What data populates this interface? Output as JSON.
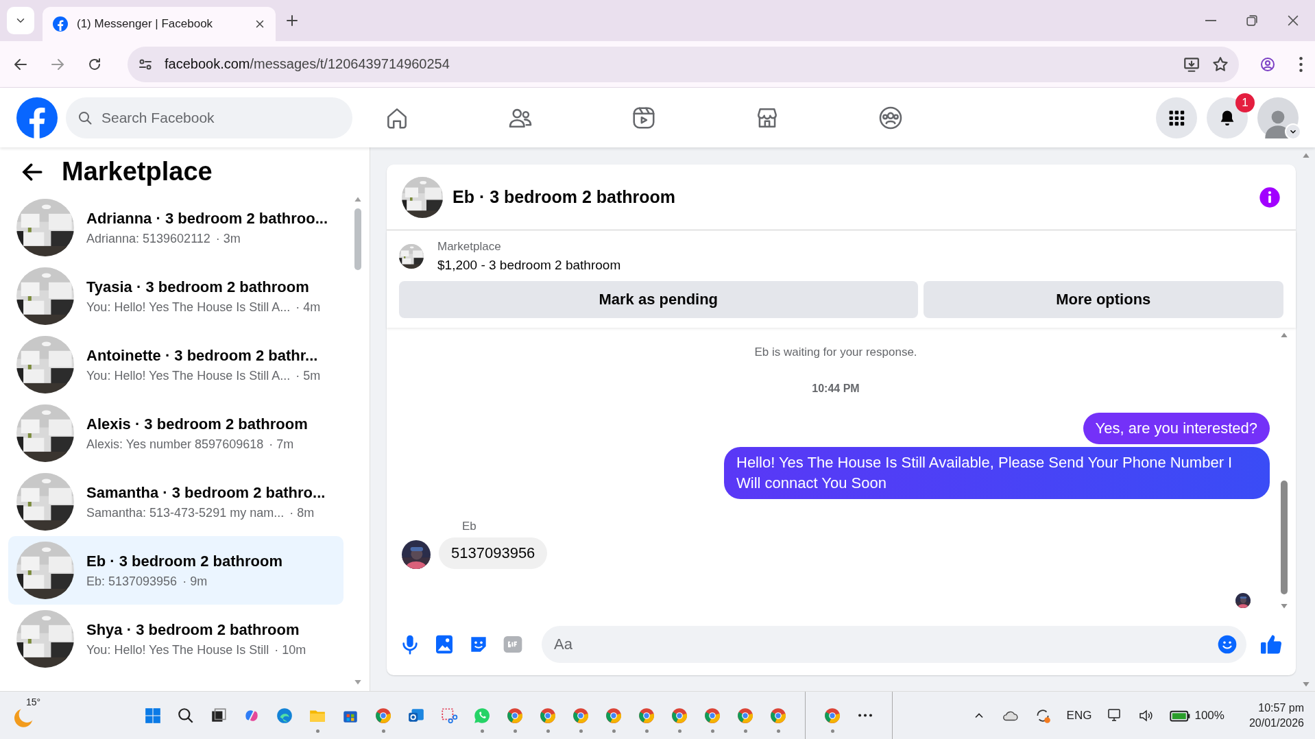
{
  "browser": {
    "tab_title": "(1) Messenger | Facebook",
    "url_host": "facebook.com",
    "url_path": "/messages/t/1206439714960254"
  },
  "header": {
    "search": {
      "placeholder": "Search Facebook"
    },
    "notification_count": "1"
  },
  "sidebar": {
    "title": "Marketplace",
    "conversations": [
      {
        "title": "Adrianna · 3 bedroom 2 bathroo...",
        "preview": "Adrianna: 5139602112",
        "time": "· 3m",
        "selected": false
      },
      {
        "title": "Tyasia · 3 bedroom 2 bathroom",
        "preview": "You: Hello! Yes The House Is Still A...",
        "time": "· 4m",
        "selected": false
      },
      {
        "title": "Antoinette · 3 bedroom 2 bathr...",
        "preview": "You: Hello! Yes The House Is Still A...",
        "time": "· 5m",
        "selected": false
      },
      {
        "title": "Alexis · 3 bedroom 2 bathroom",
        "preview": "Alexis: Yes number 8597609618",
        "time": "· 7m",
        "selected": false
      },
      {
        "title": "Samantha · 3 bedroom 2 bathro...",
        "preview": "Samantha: 513-473-5291 my nam...",
        "time": "· 8m",
        "selected": false
      },
      {
        "title": "Eb · 3 bedroom 2 bathroom",
        "preview": "Eb: 5137093956",
        "time": "· 9m",
        "selected": true
      },
      {
        "title": "Shya · 3 bedroom 2 bathroom",
        "preview": "You: Hello! Yes The House Is Still",
        "time": "· 10m",
        "selected": false
      }
    ]
  },
  "chat": {
    "title": "Eb · 3 bedroom 2 bathroom",
    "listing": {
      "label": "Marketplace",
      "text": "$1,200 - 3 bedroom 2 bathroom"
    },
    "buttons": [
      "Mark as pending",
      "More options"
    ],
    "messages": [
      {
        "kind": "notice",
        "text": "Eb is waiting for your response."
      },
      {
        "kind": "time",
        "text": "10:44 PM"
      },
      {
        "kind": "sent",
        "text": "Yes, are you interested?"
      },
      {
        "kind": "sent",
        "text": "Hello! Yes The House  Is Still Available, Please Send Your Phone Number I Will connact You Soon"
      },
      {
        "kind": "sender",
        "text": "Eb"
      },
      {
        "kind": "received",
        "text": "5137093956"
      }
    ],
    "composer": {
      "placeholder": "Aa"
    }
  },
  "taskbar": {
    "weather": "15°",
    "language": "ENG",
    "battery": "100%",
    "time": "10:57 pm",
    "date": "20/01/2026"
  }
}
